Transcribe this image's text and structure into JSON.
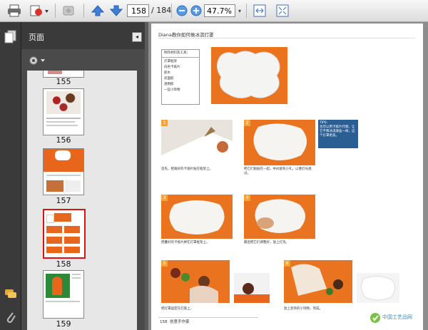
{
  "toolbar": {
    "page_current": "158",
    "page_total": "/ 184",
    "zoom": "47.7%",
    "icons": [
      "print-icon",
      "share-icon",
      "tools-icon",
      "prev-page-icon",
      "next-page-icon",
      "zoom-out-icon",
      "zoom-in-icon",
      "fit-width-icon",
      "fullscreen-icon"
    ]
  },
  "panel": {
    "title": "页面",
    "collapse": "◂",
    "options_icon": "gear-icon"
  },
  "thumbnails": [
    {
      "label": "155"
    },
    {
      "label": "156"
    },
    {
      "label": "157"
    },
    {
      "label": "158",
      "selected": true
    },
    {
      "label": "159"
    }
  ],
  "document": {
    "heading": "Diana教你如何做冰淇灯罩",
    "materials_title": "制作材料及工具：",
    "materials": [
      "灯罩框架",
      "白色卡纸片",
      "胶水",
      "双面胶",
      "透明胶",
      "一些小饰物"
    ],
    "tips_title": "TIPS:",
    "tips_text": "也可以用卡纸片代替，让它不像冰淇淋盒一样，这个灯罩更美。",
    "captions": [
      "首先，把裁好的卡纸片贴在框架上。",
      "把它们粘贴在一起，中间留有小孔，以便灯光透过。",
      "把叠好的卡纸片拼在灯罩框架上。",
      "最后把它们调整好，放上灯泡。",
      "把灯罩固定在灯座上。",
      "放上装饰的小饰物，完成。"
    ],
    "step_numbers": [
      "1",
      "2",
      "3",
      "4",
      "5",
      "6"
    ],
    "footer_page": "158",
    "footer_text": "创意手作家",
    "watermark": "中国工艺品网"
  }
}
